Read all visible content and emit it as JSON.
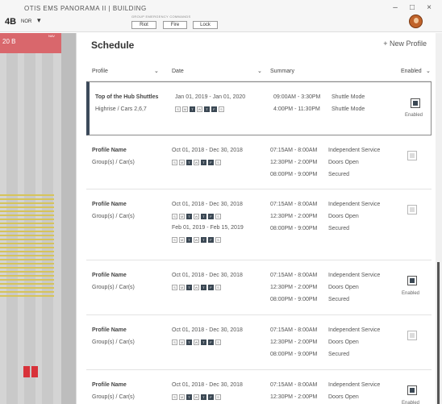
{
  "window": {
    "title": "OTIS EMS PANORAMA II | BUILDING",
    "minimize": "–",
    "maximize": "□",
    "close": "×"
  },
  "toolbar": {
    "floor": "4B",
    "mode": "NOR",
    "caret": "▾",
    "group_label": "GROUP EMERGENCY COMMANDS",
    "buttons": [
      "Riot",
      "Fire",
      "Lock"
    ]
  },
  "shaft": {
    "red_label": "20 B",
    "nav_label": "NAV"
  },
  "schedule": {
    "title": "Schedule",
    "new_profile": "+ New Profile",
    "columns": [
      {
        "label": "Profile",
        "caret": "⌄"
      },
      {
        "label": "Date",
        "caret": "⌄"
      },
      {
        "label": "Summary",
        "caret": ""
      },
      {
        "label": "Enabled",
        "caret": "⌄"
      }
    ],
    "day_letters": [
      "S",
      "M",
      "T",
      "W",
      "T",
      "F",
      "S"
    ],
    "rows": [
      {
        "name": "Top of the Hub Shuttles",
        "group": "Highrise / Cars 2,6,7",
        "dates": [
          {
            "range": "Jan 01, 2019 - Jan 01, 2020",
            "days_on": [
              false,
              false,
              true,
              false,
              true,
              true,
              false
            ]
          }
        ],
        "summary": [
          {
            "time": "09:00AM - 3:30PM",
            "mode": "Shuttle Mode"
          },
          {
            "time": "4:00PM - 11:30PM",
            "mode": "Shuttle Mode"
          }
        ],
        "enabled": true,
        "enabled_label": "Enabled"
      },
      {
        "name": "Profile Name",
        "group": "Group(s) / Car(s)",
        "dates": [
          {
            "range": "Oct 01, 2018 - Dec 30, 2018",
            "days_on": [
              false,
              false,
              true,
              false,
              true,
              true,
              false
            ]
          }
        ],
        "summary": [
          {
            "time": "07:15AM - 8:00AM",
            "mode": "Independent Service"
          },
          {
            "time": "12:30PM - 2:00PM",
            "mode": "Doors Open"
          },
          {
            "time": "08:00PM - 9:00PM",
            "mode": "Secured"
          }
        ],
        "enabled": false,
        "enabled_label": ""
      },
      {
        "name": "Profile Name",
        "group": "Group(s) / Car(s)",
        "dates": [
          {
            "range": "Oct 01, 2018 - Dec 30, 2018",
            "days_on": [
              false,
              false,
              true,
              false,
              true,
              true,
              false
            ]
          },
          {
            "range": "Feb 01, 2019 - Feb 15, 2019",
            "days_on": [
              false,
              false,
              true,
              false,
              true,
              true,
              false
            ]
          }
        ],
        "summary": [
          {
            "time": "07:15AM - 8:00AM",
            "mode": "Independent Service"
          },
          {
            "time": "12:30PM - 2:00PM",
            "mode": "Doors Open"
          },
          {
            "time": "08:00PM - 9:00PM",
            "mode": "Secured"
          }
        ],
        "enabled": false,
        "enabled_label": ""
      },
      {
        "name": "Profile Name",
        "group": "Group(s) / Car(s)",
        "dates": [
          {
            "range": "Oct 01, 2018 - Dec 30, 2018",
            "days_on": [
              false,
              false,
              true,
              false,
              true,
              true,
              false
            ]
          }
        ],
        "summary": [
          {
            "time": "07:15AM - 8:00AM",
            "mode": "Independent Service"
          },
          {
            "time": "12:30PM - 2:00PM",
            "mode": "Doors Open"
          },
          {
            "time": "08:00PM - 9:00PM",
            "mode": "Secured"
          }
        ],
        "enabled": true,
        "enabled_label": "Enabled"
      },
      {
        "name": "Profile Name",
        "group": "Group(s) / Car(s)",
        "dates": [
          {
            "range": "Oct 01, 2018 - Dec 30, 2018",
            "days_on": [
              false,
              false,
              true,
              false,
              true,
              true,
              false
            ]
          }
        ],
        "summary": [
          {
            "time": "07:15AM - 8:00AM",
            "mode": "Independent Service"
          },
          {
            "time": "12:30PM - 2:00PM",
            "mode": "Doors Open"
          },
          {
            "time": "08:00PM - 9:00PM",
            "mode": "Secured"
          }
        ],
        "enabled": false,
        "enabled_label": ""
      },
      {
        "name": "Profile Name",
        "group": "Group(s) / Car(s)",
        "dates": [
          {
            "range": "Oct 01, 2018 - Dec 30, 2018",
            "days_on": [
              false,
              false,
              true,
              false,
              true,
              true,
              false
            ]
          }
        ],
        "summary": [
          {
            "time": "07:15AM - 8:00AM",
            "mode": "Independent Service"
          },
          {
            "time": "12:30PM - 2:00PM",
            "mode": "Doors Open"
          }
        ],
        "enabled": true,
        "enabled_label": "Enabled"
      }
    ]
  }
}
